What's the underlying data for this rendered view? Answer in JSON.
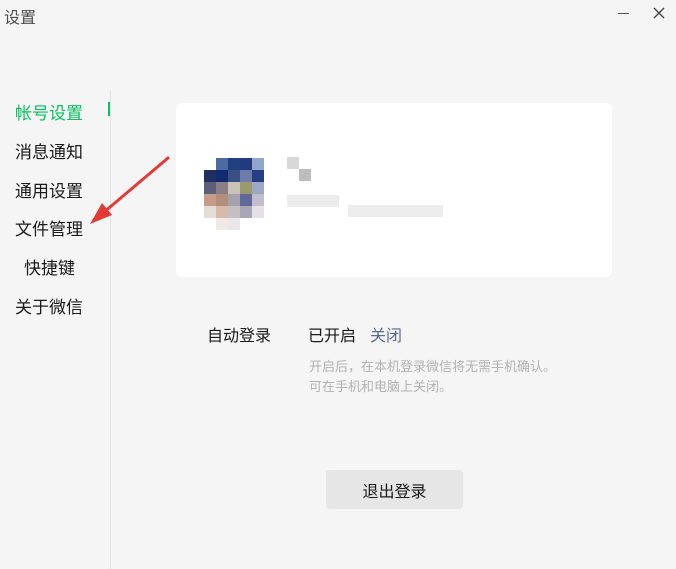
{
  "window": {
    "title": "设置",
    "minimize_glyph": "—",
    "close_glyph": "✕"
  },
  "sidebar": {
    "items": [
      {
        "label": "帐号设置",
        "active": true
      },
      {
        "label": "消息通知"
      },
      {
        "label": "通用设置"
      },
      {
        "label": "文件管理"
      },
      {
        "label": "快捷键"
      },
      {
        "label": "关于微信"
      }
    ],
    "accent_color": "#07c160"
  },
  "account": {
    "auto_login_label": "自动登录",
    "auto_login_status": "已开启",
    "auto_login_action": "关闭",
    "hint_line1": "开启后，在本机登录微信将无需手机确认。",
    "hint_line2": "可在手机和电脑上关闭。",
    "logout_label": "退出登录"
  },
  "annotation": {
    "arrow_color": "#e53935"
  }
}
